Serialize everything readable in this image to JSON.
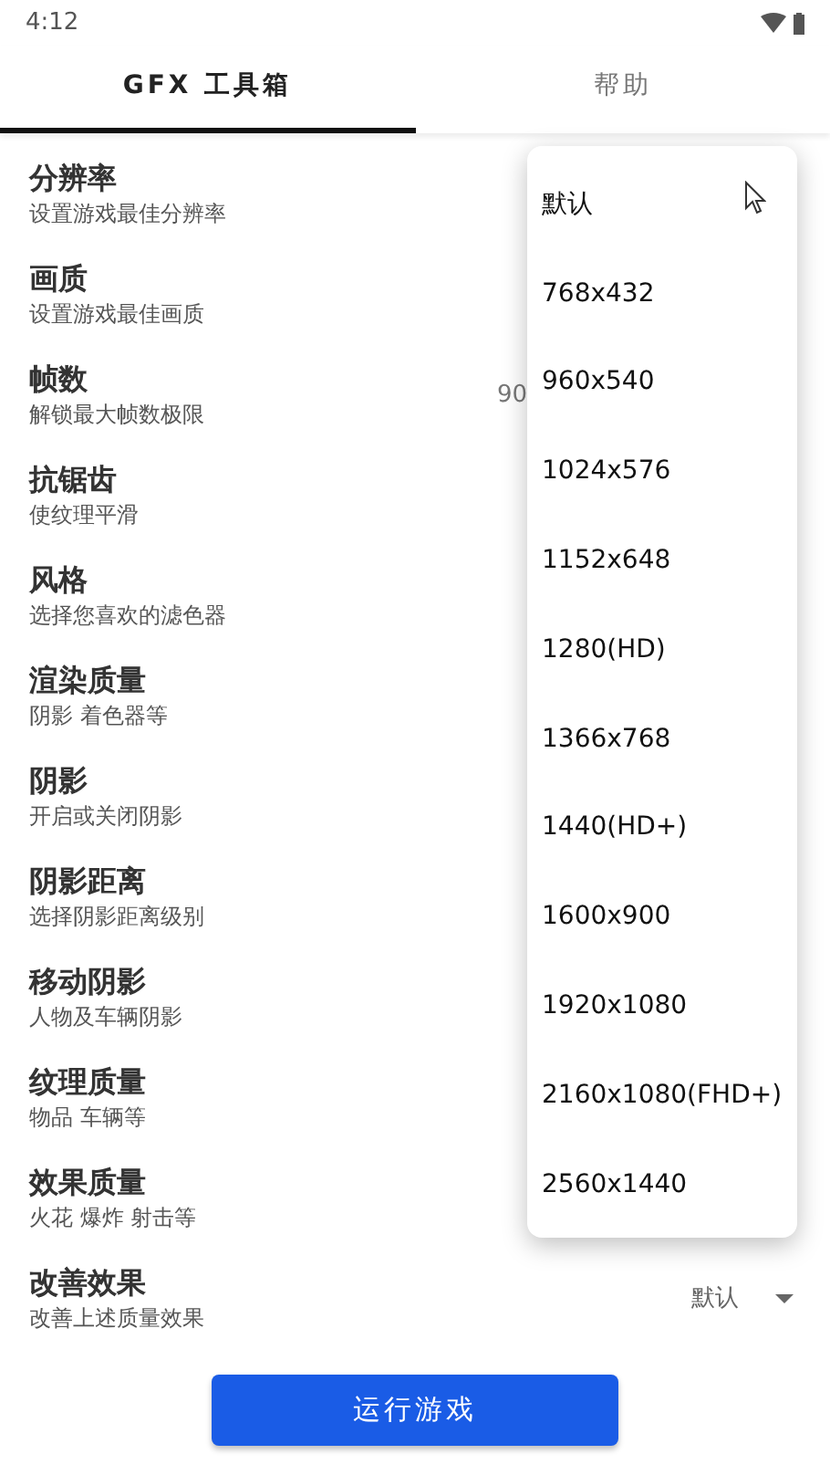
{
  "status_bar": {
    "time": "4:12"
  },
  "tabs": [
    {
      "label": "GFX 工具箱",
      "selected": true
    },
    {
      "label": "帮助",
      "selected": false
    }
  ],
  "settings": [
    {
      "title": "分辨率",
      "subtitle": "设置游戏最佳分辨率"
    },
    {
      "title": "画质",
      "subtitle": "设置游戏最佳画质"
    },
    {
      "title": "帧数",
      "subtitle": "解锁最大帧数极限",
      "value": "90"
    },
    {
      "title": "抗锯齿",
      "subtitle": "使纹理平滑"
    },
    {
      "title": "风格",
      "subtitle": "选择您喜欢的滤色器"
    },
    {
      "title": "渲染质量",
      "subtitle": "阴影 着色器等"
    },
    {
      "title": "阴影",
      "subtitle": "开启或关闭阴影"
    },
    {
      "title": "阴影距离",
      "subtitle": "选择阴影距离级别"
    },
    {
      "title": "移动阴影",
      "subtitle": "人物及车辆阴影"
    },
    {
      "title": "纹理质量",
      "subtitle": "物品 车辆等"
    },
    {
      "title": "效果质量",
      "subtitle": "火花 爆炸 射击等"
    },
    {
      "title": "改善效果",
      "subtitle": "改善上述质量效果",
      "value": "默认",
      "dropdown": true
    }
  ],
  "run_button": "运行游戏",
  "dropdown_menu": [
    "默认",
    "768x432",
    "960x540",
    "1024x576",
    "1152x648",
    "1280(HD)",
    "1366x768",
    "1440(HD+)",
    "1600x900",
    "1920x1080",
    "2160x1080(FHD+)",
    "2560x1440"
  ]
}
